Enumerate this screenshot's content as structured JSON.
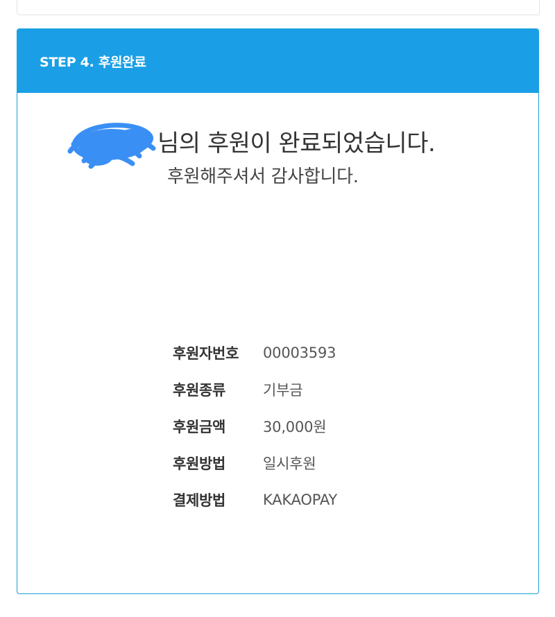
{
  "panel": {
    "title": "STEP 4. 후원완료"
  },
  "completion": {
    "headline": "님의 후원이 완료되었습니다.",
    "subline": "후원해주셔서 감사합니다."
  },
  "details": [
    {
      "label": "후원자번호",
      "value": "00003593"
    },
    {
      "label": "후원종류",
      "value": "기부금"
    },
    {
      "label": "후원금액",
      "value": "30,000원"
    },
    {
      "label": "후원방법",
      "value": "일시후원"
    },
    {
      "label": "결제방법",
      "value": "KAKAOPAY"
    }
  ],
  "colors": {
    "header_bg": "#1a9fe6",
    "border": "#1aa0d9",
    "redaction": "#3a8ff5"
  }
}
